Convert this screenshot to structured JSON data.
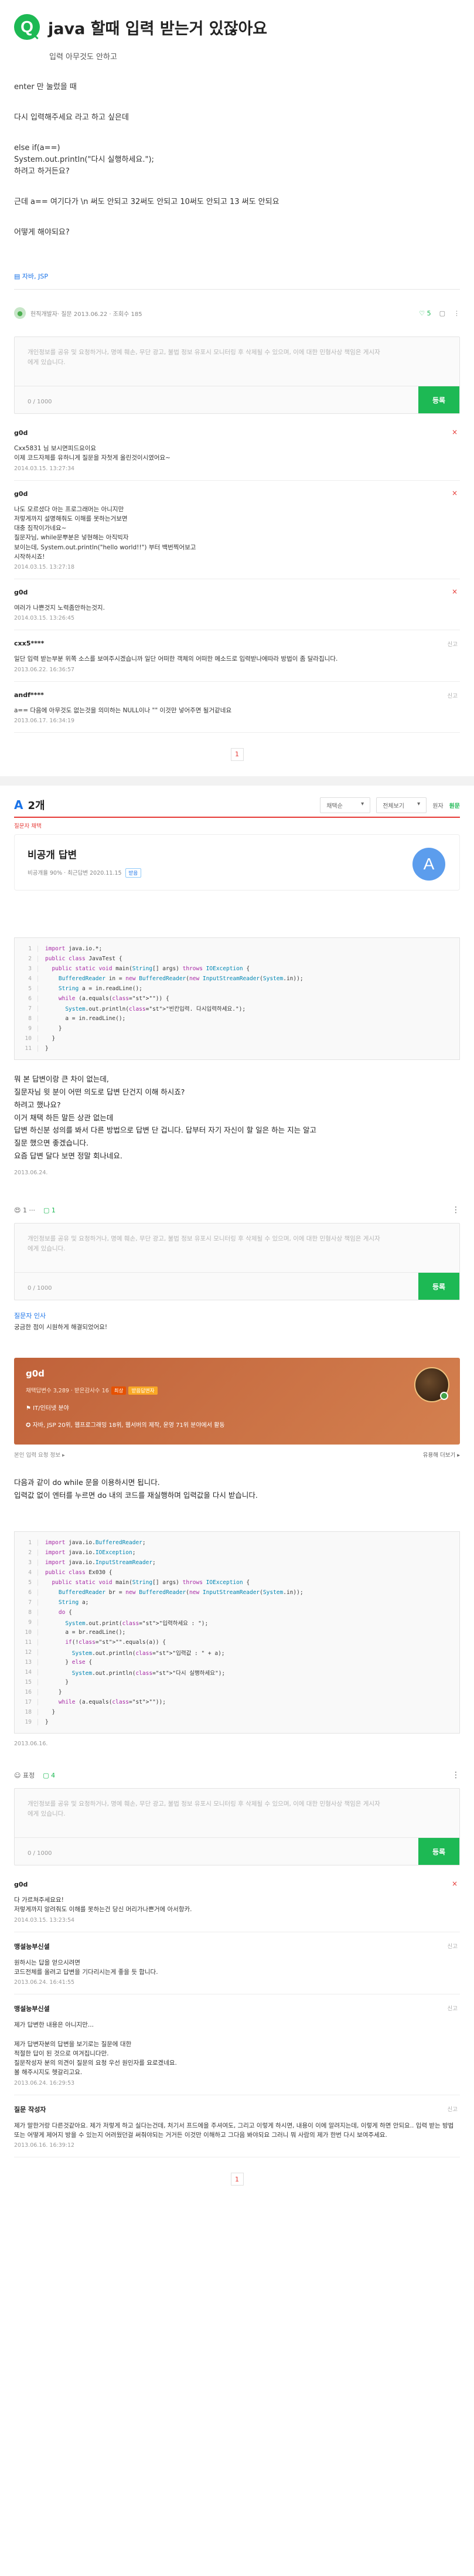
{
  "question": {
    "badge": "Q",
    "title": "java 할때 입력 받는거 있잖아요",
    "subtitle": "입력 아무것도 안하고",
    "body": [
      "enter 만 눌렀을 때",
      "",
      "다시 입력해주세요 라고 하고 싶은데",
      "",
      "else if(a==)",
      "    System.out.println(\"다시 실행하세요.\");",
      "하려고 하거든요?",
      "",
      "근데 a== 여기다가 \\n 써도 안되고 32써도 안되고 10써도 안되고 13 써도 안되요",
      "",
      "어떻게 해야되요?"
    ],
    "tag": "자바, JSP",
    "author": "헌직개발자",
    "meta": "· 질문 2013.06.22 · 조회수 185",
    "like_count": "5"
  },
  "comment_box": {
    "placeholder": "개인정보를 공유 및 요청하거나, 명예 훼손, 무단 광고, 불법 정보 유포시 모니터링 후 삭제될 수 있으며, 이에 대한 민형사상 책임은 게시자에게 있습니다.",
    "count": "0 / 1000",
    "submit": "등록"
  },
  "comments": [
    {
      "author": "g0d",
      "text": "Cxx5831 님 보시면피드요이요\n이제 코드자체를 유하니게 질문을 자첫게 올린것이시였어요~",
      "date": "2014.03.15. 13:27:34",
      "action": "×"
    },
    {
      "author": "g0d",
      "text": "나도 모르셨다 아는 프로그래머는 아니지만\n저렇게까지 설명해줘도 이해를 못하는거보면\n대충 짐작이가네요~\n질문자님, while문뿌분은 넣현해는 아직빅자\n보이는데, System.out.println(\"hello world!!\") 부터 백번찍어보고\n시작하시죠!",
      "date": "2014.03.15. 13:27:18",
      "action": "×"
    },
    {
      "author": "g0d",
      "text": "여러가 나쁜것지 노력좀안하는것지.",
      "date": "2014.03.15. 13:26:45",
      "action": "×"
    },
    {
      "author": "cxx5****",
      "text": "일단 입력 받는부분 위쪽 소스를 보여주시겠습니까 일단 어떠한 객체의 어떠한 메소드로 입력받나에따라 방법이 좀 달라집니다.",
      "date": "2013.06.22. 16:36:57",
      "action": "신고"
    },
    {
      "author": "andf****",
      "text": "a== 다음에 아무것도 없는것을 의미하는 NULL이나 \"\" 이것만 넣어주면 될거같네요",
      "date": "2013.06.17. 16:34:19",
      "action": "신고"
    }
  ],
  "pager": "1",
  "answers_header": {
    "count_label": "2개",
    "sort": "채택순",
    "filter": "전체보기",
    "toggle_label": "원자",
    "toggle_state": "원문",
    "warning": "질문자 채택"
  },
  "answer1": {
    "title": "비공개 답변",
    "meta": "비공개율 90% · 최근답변 2020.11.15",
    "chip": "받음",
    "avatar": "A",
    "code": [
      "import java.io.*;",
      "public class JavaTest {",
      "  public static void main(String[] args) throws IOException {",
      "    BufferedReader in = new BufferedReader(new InputStreamReader(System.in));",
      "    String a = in.readLine();",
      "    while (a.equals(\"\")) {",
      "      System.out.println(\"빈칸입력. 다시입력하세요.\");",
      "      a = in.readLine();",
      "    }",
      "  }",
      "}"
    ],
    "text": [
      "뭐 본 답변이랑 큰 차이 없는데,",
      "질문자님 윗 분이 어떤 의도로 답변 단건지 이해 하시죠?",
      "하려고 했나요?",
      "이거 채택 하든 말든 상관 없는데",
      "답변 하신분 성의를 봐서 다른 방법으로 답변 단 겁니다. 답부터 자기 자신이 할 일은 하는 지는 알고",
      "질문 했으면 좋겠습니다.",
      "요즘 답변 달다 보면 정말 회나네요."
    ],
    "date": "2013.06.24.",
    "reactions": "1 ···",
    "comment_count": "1",
    "small_comment": {
      "author": "질문자 인사",
      "text": "궁금한 점이 시원하게 해결되었어요!"
    }
  },
  "answer2": {
    "name": "g0d",
    "meta": "채택답변수 3,289 · 받은감사수 16",
    "chip1": "최상",
    "chip2": "받음답변자",
    "field": "IT/인터넷 분야",
    "field_detail": "자바, JSP 20위, 웹프로그래밍 18위, 웹서버의 제작, 운영 71위 분야에서 활동",
    "sub_left": "본인 입력 요청 정보 ▸",
    "sub_right": "유용해 더보기 ▸",
    "intro": [
      "다음과 같이 do while 문을 이용하시면 됩니다.",
      "입력값 없이 엔터를 누르면 do 내의 코드를 재실행하며 입력값을 다시 받습니다."
    ],
    "code": [
      "import java.io.BufferedReader;",
      "import java.io.IOException;",
      "import java.io.InputStreamReader;",
      "public class Ex030 {",
      "  public static void main(String[] args) throws IOException {",
      "    BufferedReader br = new BufferedReader(new InputStreamReader(System.in));",
      "    String a;",
      "    do {",
      "      System.out.print(\"입력하세요 : \");",
      "      a = br.readLine();",
      "      if(!\"\".equals(a)) {",
      "        System.out.println(\"입력값 : \" + a);",
      "      } else {",
      "        System.out.println(\"다시 실행하세요\");",
      "      }",
      "    }",
      "    while (a.equals(\"\"));",
      "  }",
      "}"
    ],
    "date": "2013.06.16.",
    "reactions": "표정",
    "comment_count": "4"
  },
  "comments2": [
    {
      "author": "g0d",
      "text": "다 가르쳐주세요요!\n저렇게까지 알려줘도 이해를 못하는건 당신 머리가나쁜거에 아서항카.",
      "date": "2014.03.15. 13:23:54",
      "action": "×"
    },
    {
      "author": "맹설능부신셜",
      "text": "원하시는 답을 얻으시려면\n코드전체를 올려고 답변을 기다리시는게 좋을 듯 합니다.",
      "date": "2013.06.24. 16:41:55",
      "action": "신고"
    },
    {
      "author": "맹설능부신셜",
      "text": "제가 답변한 내용은 아니지만...\n\n제가 답변자분의 답변을 보기로는 질문에 대한\n적절한 답이 된 것으로 여겨집니다만.\n질문작성자 분의 의견이 질문의 요청 우선 원인자를 요로겠네요.\n볼 해주시지도 헷갈리고요.",
      "date": "2013.06.24. 16:29:53",
      "action": "신고"
    },
    {
      "author": "질문 작성자",
      "text": "제가 말한거랑 다른것같아요. 제가 저렇게 하고 실다는건데, 처기서 프드에을 주셔여도, 그리고 이렇게 하시면, 내용이 이에 알려지는데, 이렇게 하면 안되요.. 입력 받는 방법 또는 어떻게 제어지 방을 수 있는지 어려웠던걸 써줘야되는 거거든 이것만 이해하고 그다음 봐야되요 그러니 뭐 사람의 제가 한번 다시 보여주세요.",
      "date": "2013.06.16. 16:39:12",
      "action": "신고"
    }
  ],
  "pager2": "1"
}
